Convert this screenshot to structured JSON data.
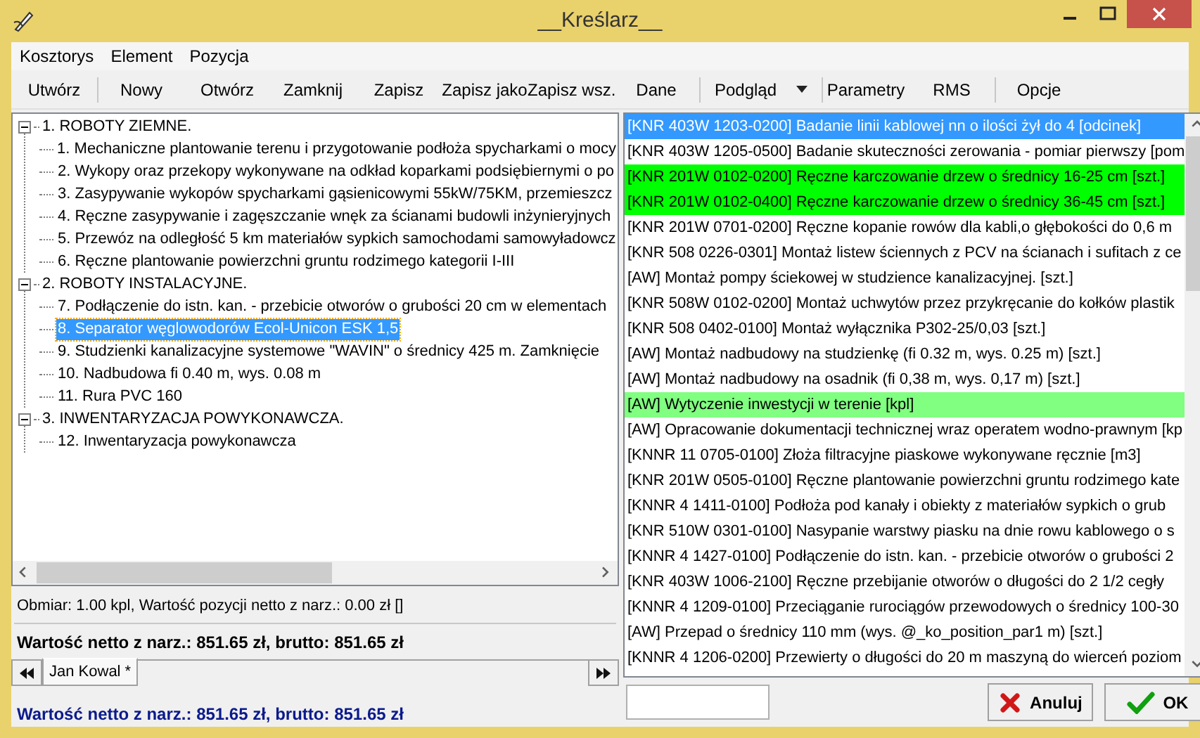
{
  "window": {
    "title": "__Kreślarz__"
  },
  "menu": [
    "Kosztorys",
    "Element",
    "Pozycja"
  ],
  "toolbar": [
    [
      {
        "label": "Utwórz",
        "kind": "button"
      }
    ],
    [
      {
        "label": "Nowy",
        "kind": "button"
      },
      {
        "label": "Otwórz",
        "kind": "button"
      },
      {
        "label": "Zamknij",
        "kind": "button"
      },
      {
        "label": "Zapisz",
        "kind": "button"
      },
      {
        "label": "Zapisz jako",
        "kind": "button"
      },
      {
        "label": "Zapisz wsz.",
        "kind": "button"
      },
      {
        "label": "Dane",
        "kind": "button"
      }
    ],
    [
      {
        "label": "Podgląd",
        "kind": "dropdown"
      }
    ],
    [
      {
        "label": "Parametry",
        "kind": "button"
      },
      {
        "label": "RMS",
        "kind": "button"
      }
    ],
    [
      {
        "label": "Opcje",
        "kind": "button"
      }
    ]
  ],
  "tree": [
    {
      "label": "1. ROBOTY ZIEMNE.",
      "expanded": true,
      "selected": false,
      "children": [
        {
          "label": "1. Mechaniczne plantowanie terenu i przygotowanie podłoża spycharkami o mocy",
          "selected": false
        },
        {
          "label": "2. Wykopy oraz przekopy wykonywane na odkład koparkami podsiębiernymi o po",
          "selected": false
        },
        {
          "label": "3. Zasypywanie wykopów spycharkami gąsienicowymi 55kW/75KM, przemieszcz",
          "selected": false
        },
        {
          "label": "4. Ręczne zasypywanie i zagęszczanie wnęk za ścianami budowli inżynieryjnych",
          "selected": false
        },
        {
          "label": "5. Przewóz na odległość 5 km materiałów sypkich samochodami samowyładowcz",
          "selected": false
        },
        {
          "label": "6. Ręczne plantowanie powierzchni gruntu rodzimego kategorii I-III",
          "selected": false
        }
      ]
    },
    {
      "label": "2. ROBOTY INSTALACYJNE.",
      "expanded": true,
      "selected": false,
      "children": [
        {
          "label": "7. Podłączenie do istn. kan. - przebicie otworów o grubości 20 cm w elementach",
          "selected": false
        },
        {
          "label": "8. Separator węglowodorów Ecol-Unicon ESK 1,5",
          "selected": true
        },
        {
          "label": "9. Studzienki kanalizacyjne systemowe \"WAVIN\" o średnicy 425 m. Zamknięcie",
          "selected": false
        },
        {
          "label": "10. Nadbudowa fi 0.40 m, wys. 0.08 m",
          "selected": false
        },
        {
          "label": "11. Rura PVC 160",
          "selected": false
        }
      ]
    },
    {
      "label": "3. INWENTARYZACJA POWYKONAWCZA.",
      "expanded": true,
      "selected": false,
      "children": [
        {
          "label": "12. Inwentaryzacja powykonawcza",
          "selected": false
        }
      ]
    }
  ],
  "status_line": "Obmiar: 1.00 kpl, Wartość pozycji netto z narz.: 0.00 zł []",
  "total_line": "Wartość netto z narz.: 851.65 zł, brutto: 851.65 zł",
  "tabs": [
    {
      "label": "Jan Kowal *",
      "selected": true
    }
  ],
  "summary_line": "Wartość netto z narz.: 851.65 zł, brutto: 851.65 zł",
  "catalog": [
    {
      "label": "[KNR 403W 1203-0200] Badanie linii kablowej nn o ilości żył do 4 [odcinek]",
      "selected": true
    },
    {
      "label": "[KNR 403W 1205-0500] Badanie skuteczności zerowania - pomiar pierwszy [pom",
      "selected": false
    },
    {
      "label": "[KNR 201W 0102-0200] Ręczne karczowanie drzew o średnicy 16-25 cm [szt.]",
      "selected": false,
      "color": "#00ff00"
    },
    {
      "label": "[KNR 201W 0102-0400] Ręczne karczowanie drzew o średnicy 36-45 cm [szt.]",
      "selected": false,
      "color": "#00ff00"
    },
    {
      "label": "[KNR 201W 0701-0200] Ręczne kopanie rowów dla kabli,o głębokości do 0,6 m",
      "selected": false
    },
    {
      "label": "[KNR 508 0226-0301] Montaż listew ściennych z PCV na ścianach i sufitach z ce",
      "selected": false
    },
    {
      "label": "[AW] Montaż pompy ściekowej w studzience kanalizacyjnej. [szt.]",
      "selected": false
    },
    {
      "label": "[KNR 508W 0102-0200] Montaż uchwytów przez przykręcanie do kołków plastik",
      "selected": false
    },
    {
      "label": "[KNR 508 0402-0100] Montaż wyłącznika P302-25/0,03 [szt.]",
      "selected": false
    },
    {
      "label": "[AW] Montaż nadbudowy na studzienkę (fi 0.32 m, wys. 0.25 m) [szt.]",
      "selected": false
    },
    {
      "label": "[AW] Montaż nadbudowy na osadnik (fi 0,38 m, wys. 0,17 m) [szt.]",
      "selected": false
    },
    {
      "label": "[AW] Wytyczenie inwestycji w terenie [kpl]",
      "selected": false,
      "color": "#80ff80"
    },
    {
      "label": "[AW] Opracowanie dokumentacji technicznej wraz operatem wodno-prawnym [kp",
      "selected": false
    },
    {
      "label": "[KNNR 11 0705-0100] Złoża filtracyjne piaskowe wykonywane ręcznie [m3]",
      "selected": false
    },
    {
      "label": "[KNR 201W 0505-0100] Ręczne plantowanie powierzchni gruntu rodzimego kate",
      "selected": false
    },
    {
      "label": "[KNNR 4 1411-0100] Podłoża pod kanały i obiekty z materiałów sypkich o grub",
      "selected": false
    },
    {
      "label": "[KNR 510W 0301-0100] Nasypanie warstwy piasku na dnie rowu kablowego o s",
      "selected": false
    },
    {
      "label": "[KNNR 4 1427-0100] Podłączenie do istn. kan. - przebicie otworów o grubości 2",
      "selected": false
    },
    {
      "label": "[KNR 403W 1006-2100] Ręczne przebijanie otworów o długości do 2 1/2 cegły",
      "selected": false
    },
    {
      "label": "[KNNR 4 1209-0100] Przeciąganie rurociągów przewodowych o średnicy 100-30",
      "selected": false
    },
    {
      "label": "[AW] Przepad o średnicy 110 mm (wys. @_ko_position_par1 m) [szt.]",
      "selected": false
    },
    {
      "label": "[KNNR 4 1206-0200] Przewierty o długości do 20 m maszyną do wierceń poziom",
      "selected": false
    }
  ],
  "buttons": [
    {
      "label": "Anuluj",
      "kind": "cancel"
    },
    {
      "label": "OK",
      "kind": "ok"
    }
  ]
}
